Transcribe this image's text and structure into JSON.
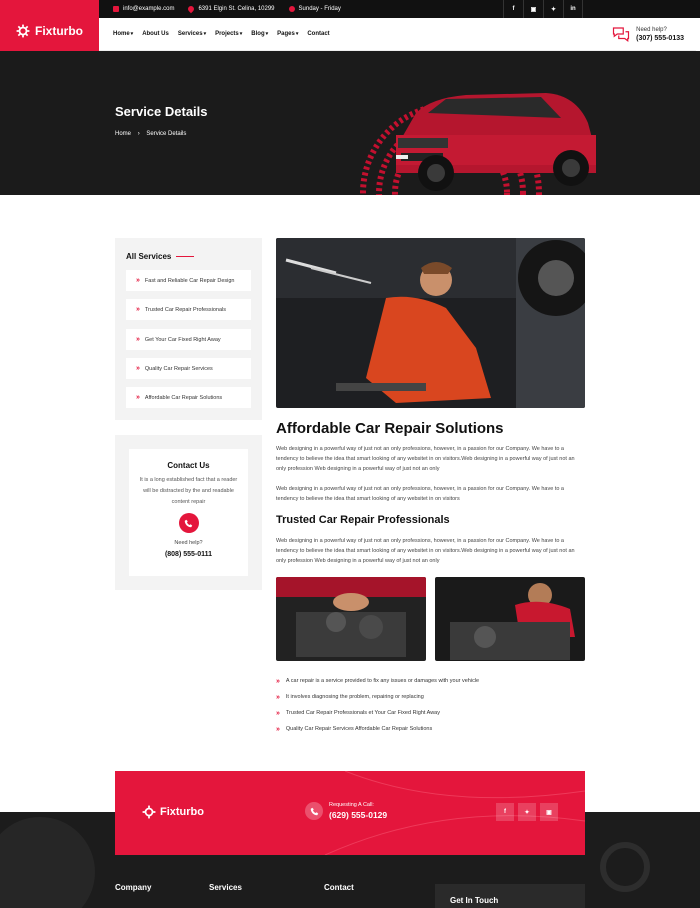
{
  "brand": {
    "name": "Fixturbo",
    "accent": "#e4163c",
    "dark": "#1b1b1b"
  },
  "topbar": {
    "email": "info@example.com",
    "address": "6391 Elgin St. Celina, 10299",
    "hours": "Sunday - Friday",
    "social": [
      "f",
      "in-ig",
      "t",
      "in"
    ]
  },
  "nav": {
    "items": [
      {
        "label": "Home",
        "dropdown": true
      },
      {
        "label": "About Us",
        "dropdown": false
      },
      {
        "label": "Services",
        "dropdown": true
      },
      {
        "label": "Projects",
        "dropdown": true
      },
      {
        "label": "Blog",
        "dropdown": true
      },
      {
        "label": "Pages",
        "dropdown": true
      },
      {
        "label": "Contact",
        "dropdown": false
      }
    ],
    "help_label": "Need help?",
    "help_phone": "(307) 555-0133"
  },
  "hero": {
    "title": "Service Details",
    "breadcrumb": [
      "Home",
      "Service Details"
    ]
  },
  "sidebar": {
    "title": "All Services",
    "services": [
      "Fast and Reliable Car Repair Design",
      "Trusted Car Repair Professionals",
      "Get Your Car Fixed Right Away",
      "Quality Car Repair Services",
      "Affordable Car Repair Solutions"
    ]
  },
  "contact_card": {
    "title": "Contact Us",
    "text": "It is a long established fact that a reader will be distracted by the and readable content repair",
    "need_help": "Need help?",
    "phone": "(808) 555-0111"
  },
  "main": {
    "heading": "Affordable Car Repair Solutions",
    "para1": "Web designing in a powerful way of just not an only professions, however, in a passion for our Company. We have to a tendency to believe the idea that smart looking of any websitet in on visitors.Web designing in a powerful way of just not an only profession Web designing in a powerful way of just not an only",
    "para2": "Web designing in a powerful way of just not an only professions, however, in a passion for our Company. We have to a tendency to believe the idea that smart looking of any websitet in on visitors",
    "subheading": "Trusted Car Repair Professionals",
    "para3": "Web designing in a powerful way of just not an only professions, however, in a passion for our Company. We have to a tendency to believe the idea that smart looking of any websitet in on visitors.Web designing in a powerful way of just not an only profession Web designing in a powerful way of just not an only",
    "bullets": [
      "A car repair is a service provided to fix any issues or damages with your vehicle",
      "It involves diagnosing the problem, repairing or replacing",
      "Trusted Car Repair Professionals et Your Car Fixed Right Away",
      "Quality Car Repair Services Affordable Car Repair Solutions"
    ]
  },
  "cta": {
    "brand": "Fixturbo",
    "request_label": "Requesting A Call:",
    "phone": "(629) 555-0129",
    "social": [
      "f",
      "t",
      "ig"
    ]
  },
  "footer": {
    "columns": [
      "Company",
      "Services",
      "Contact"
    ],
    "get_in_touch": "Get In Touch"
  }
}
